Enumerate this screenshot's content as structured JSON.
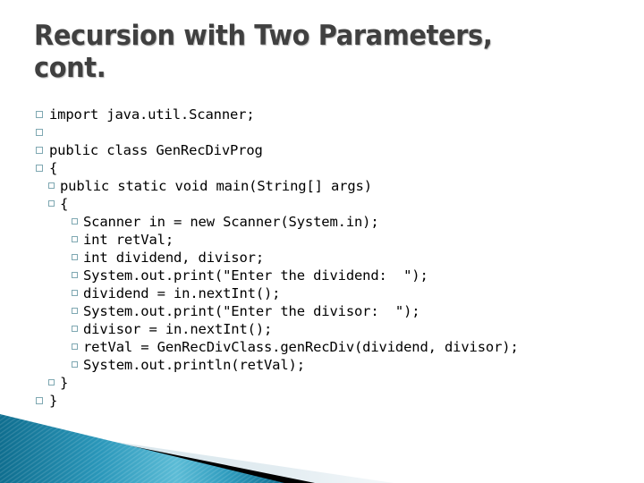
{
  "slide": {
    "title": "Recursion with Two Parameters, cont.",
    "background_color": "#ffffff",
    "title_color": "#404040",
    "bullet_color": "#7fa8b2",
    "code_color": "#000000"
  },
  "decor": {
    "teal_dark": "#137a9c",
    "teal_light": "#56b6d2",
    "black": "#000000",
    "pale": "#dde8ed"
  },
  "code_lines": [
    {
      "level": 1,
      "bullet": true,
      "text": "import java.util.Scanner;"
    },
    {
      "level": 1,
      "bullet": true,
      "text": ""
    },
    {
      "level": 1,
      "bullet": true,
      "text": "public class GenRecDivProg"
    },
    {
      "level": 1,
      "bullet": true,
      "text": "{"
    },
    {
      "level": 2,
      "bullet": true,
      "text": "public static void main(String[] args)"
    },
    {
      "level": 2,
      "bullet": true,
      "text": "{"
    },
    {
      "level": 3,
      "bullet": true,
      "text": "Scanner in = new Scanner(System.in);"
    },
    {
      "level": 3,
      "bullet": true,
      "text": "int retVal;"
    },
    {
      "level": 3,
      "bullet": true,
      "text": "int dividend, divisor;"
    },
    {
      "level": 3,
      "bullet": true,
      "text": "System.out.print(\"Enter the dividend:  \");"
    },
    {
      "level": 3,
      "bullet": true,
      "text": "dividend = in.nextInt();"
    },
    {
      "level": 3,
      "bullet": true,
      "text": "System.out.print(\"Enter the divisor:  \");"
    },
    {
      "level": 3,
      "bullet": true,
      "text": "divisor = in.nextInt();"
    },
    {
      "level": 3,
      "bullet": true,
      "text": "retVal = GenRecDivClass.genRecDiv(dividend, divisor);"
    },
    {
      "level": 3,
      "bullet": true,
      "text": "System.out.println(retVal);"
    },
    {
      "level": 2,
      "bullet": true,
      "text": "}"
    },
    {
      "level": 1,
      "bullet": true,
      "text": "}"
    }
  ]
}
